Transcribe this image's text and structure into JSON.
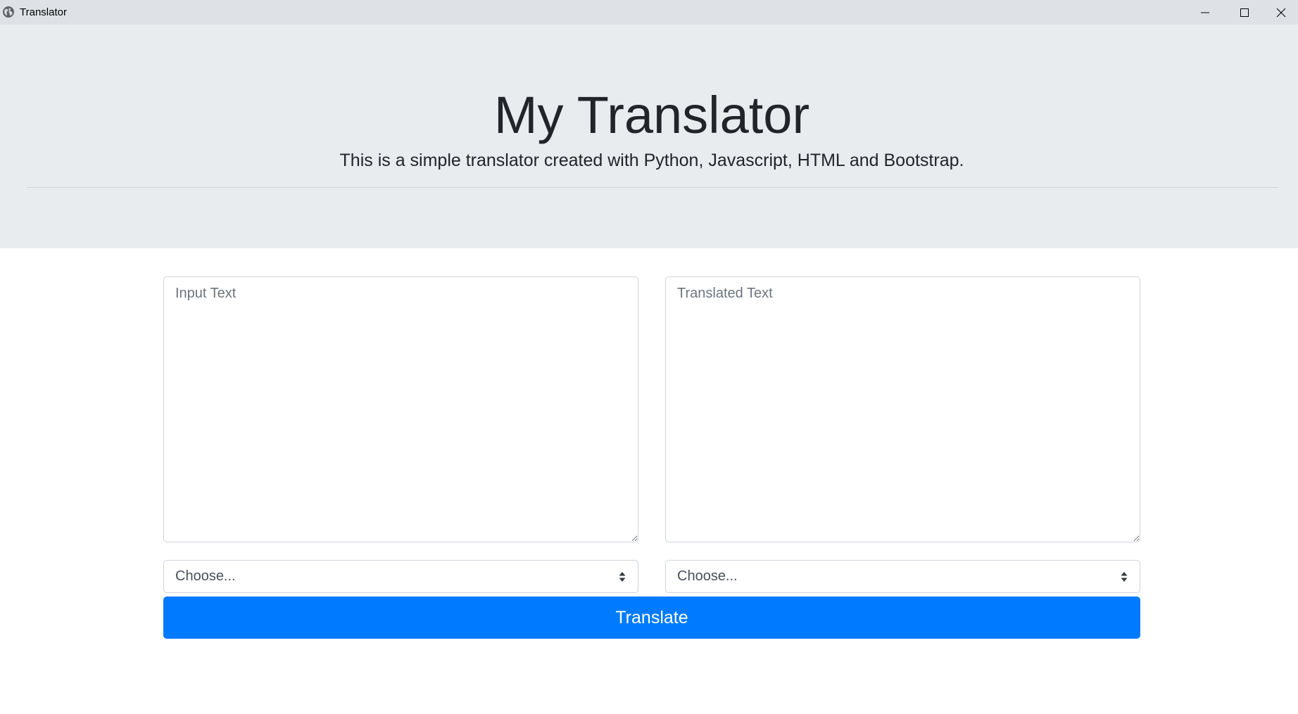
{
  "window": {
    "title": "Translator",
    "icon": "globe-icon",
    "controls": [
      "minimize-icon",
      "maximize-icon",
      "close-icon"
    ]
  },
  "header": {
    "title": "My Translator",
    "lead": "This is a simple translator created with Python, Javascript, HTML and Bootstrap."
  },
  "form": {
    "input_placeholder": "Input Text",
    "input_value": "",
    "output_placeholder": "Translated Text",
    "output_value": "",
    "source_language": "Choose...",
    "target_language": "Choose...",
    "translate_label": "Translate"
  },
  "colors": {
    "header_background": "#e9ecef",
    "primary_button": "#007bff",
    "border": "#ced4da"
  }
}
